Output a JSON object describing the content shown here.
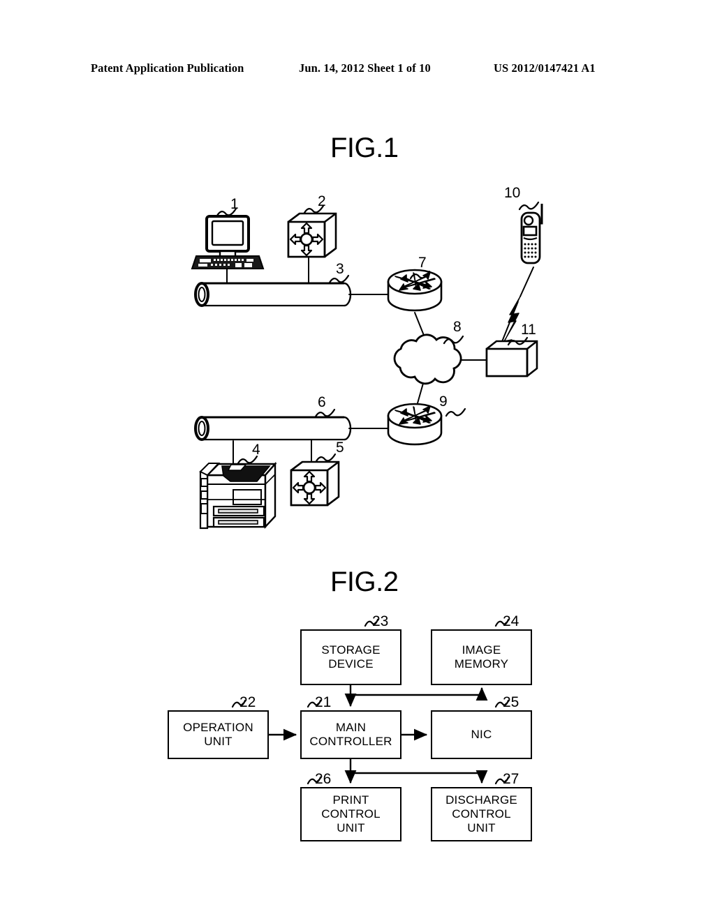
{
  "header": {
    "left": "Patent Application Publication",
    "middle": "Jun. 14, 2012  Sheet 1 of 10",
    "right": "US 2012/0147421 A1"
  },
  "figures": [
    {
      "id": "fig1",
      "title": "FIG.1",
      "type": "network-topology-diagram",
      "elements": [
        {
          "ref": "1",
          "name": "personal-computer",
          "icon": "crt-computer-icon"
        },
        {
          "ref": "2",
          "name": "network-switch-upper",
          "icon": "switch-cube-icon"
        },
        {
          "ref": "3",
          "name": "network-bus-upper",
          "icon": "bus-cylinder-icon"
        },
        {
          "ref": "4",
          "name": "multifunction-printer",
          "icon": "mfp-printer-icon"
        },
        {
          "ref": "5",
          "name": "network-switch-lower",
          "icon": "switch-cube-icon"
        },
        {
          "ref": "6",
          "name": "network-bus-lower",
          "icon": "bus-cylinder-icon"
        },
        {
          "ref": "7",
          "name": "router-upper",
          "icon": "router-cylinder-icon"
        },
        {
          "ref": "8",
          "name": "network-cloud",
          "icon": "cloud-icon"
        },
        {
          "ref": "9",
          "name": "router-lower",
          "icon": "router-cylinder-icon"
        },
        {
          "ref": "10",
          "name": "mobile-phone",
          "icon": "mobile-phone-icon"
        },
        {
          "ref": "11",
          "name": "base-station",
          "icon": "base-station-box-icon"
        }
      ]
    },
    {
      "id": "fig2",
      "title": "FIG.2",
      "type": "block-diagram",
      "blocks": [
        {
          "ref": "21",
          "label": "MAIN\nCONTROLLER",
          "name": "main-controller"
        },
        {
          "ref": "22",
          "label": "OPERATION\nUNIT",
          "name": "operation-unit"
        },
        {
          "ref": "23",
          "label": "STORAGE\nDEVICE",
          "name": "storage-device"
        },
        {
          "ref": "24",
          "label": "IMAGE\nMEMORY",
          "name": "image-memory"
        },
        {
          "ref": "25",
          "label": "NIC",
          "name": "nic"
        },
        {
          "ref": "26",
          "label": "PRINT\nCONTROL\nUNIT",
          "name": "print-control-unit"
        },
        {
          "ref": "27",
          "label": "DISCHARGE\nCONTROL\nUNIT",
          "name": "discharge-control-unit"
        }
      ],
      "connections": [
        {
          "from": "22",
          "to": "21"
        },
        {
          "from": "23",
          "to": "21"
        },
        {
          "from": "23",
          "to": "24"
        },
        {
          "from": "21",
          "to": "25"
        },
        {
          "from": "21",
          "to": "26"
        },
        {
          "from": "21",
          "to": "27"
        }
      ]
    }
  ],
  "colors": {
    "ink": "#000000",
    "paper": "#ffffff"
  }
}
